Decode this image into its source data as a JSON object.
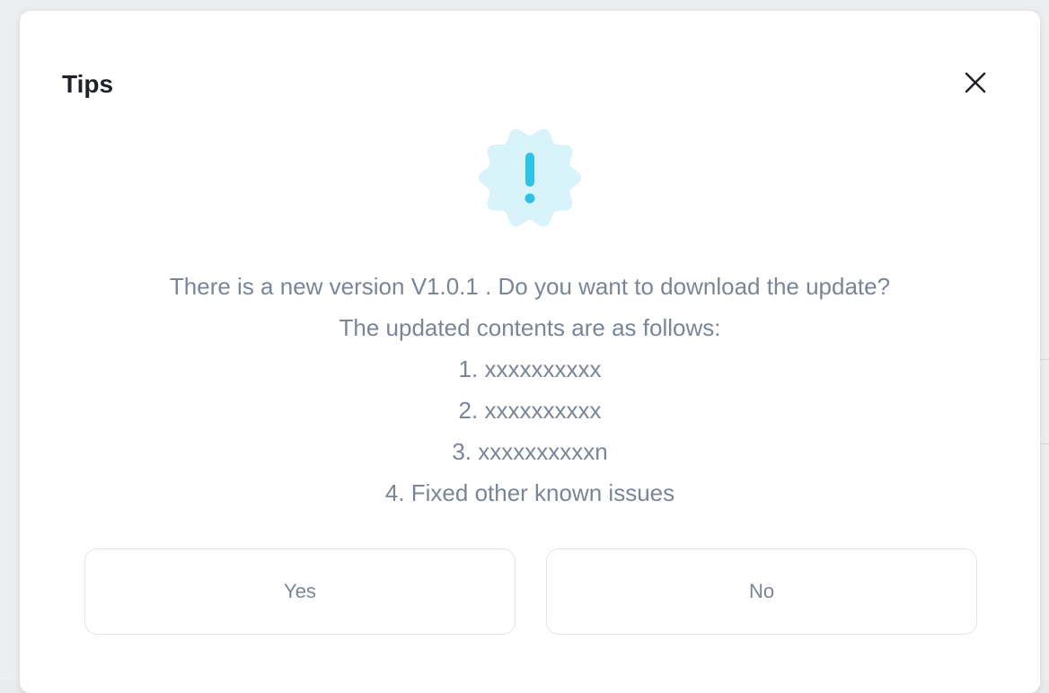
{
  "dialog": {
    "title": "Tips",
    "close_icon": "close-icon",
    "status_icon": "exclamation-badge-icon",
    "accent_color": "#2ec3e6",
    "badge_color": "#d9f3fa",
    "message_lines": [
      "There is a new version V1.0.1 . Do you want to download the update?",
      "The updated contents are as follows:",
      "1. xxxxxxxxxx",
      "2. xxxxxxxxxx",
      "3. xxxxxxxxxxn",
      "4. Fixed other known issues"
    ],
    "yes_label": "Yes",
    "no_label": "No"
  }
}
